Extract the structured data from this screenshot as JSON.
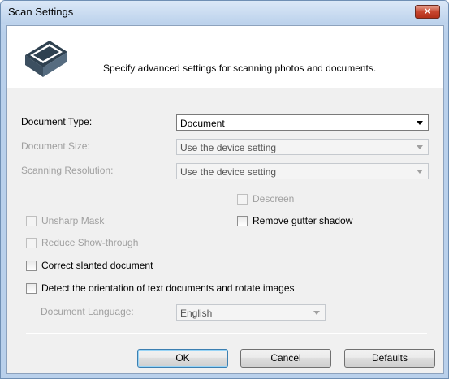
{
  "window": {
    "title": "Scan Settings",
    "close_label": "✕"
  },
  "header": {
    "text": "Specify advanced settings for scanning photos and documents."
  },
  "fields": {
    "document_type": {
      "label": "Document Type:",
      "value": "Document"
    },
    "document_size": {
      "label": "Document Size:",
      "value": "Use the device setting"
    },
    "scanning_resolution": {
      "label": "Scanning Resolution:",
      "value": "Use the device setting"
    },
    "document_language": {
      "label": "Document Language:",
      "value": "English"
    }
  },
  "checkboxes": {
    "descreen": {
      "label": "Descreen",
      "checked": false,
      "enabled": false
    },
    "unsharp_mask": {
      "label": "Unsharp Mask",
      "checked": false,
      "enabled": false
    },
    "remove_gutter_shadow": {
      "label": "Remove gutter shadow",
      "checked": false,
      "enabled": true
    },
    "reduce_show_through": {
      "label": "Reduce Show-through",
      "checked": false,
      "enabled": false
    },
    "correct_slanted": {
      "label": "Correct slanted document",
      "checked": false,
      "enabled": true
    },
    "detect_orientation": {
      "label": "Detect the orientation of text documents and rotate images",
      "checked": false,
      "enabled": true
    }
  },
  "buttons": {
    "ok": "OK",
    "cancel": "Cancel",
    "defaults": "Defaults"
  },
  "icons": {
    "header": "scanner-icon",
    "close": "close-icon"
  },
  "colors": {
    "title_bar": "#bcd2ec",
    "close_button": "#c7462f",
    "client_bg": "#f0f0f0"
  }
}
